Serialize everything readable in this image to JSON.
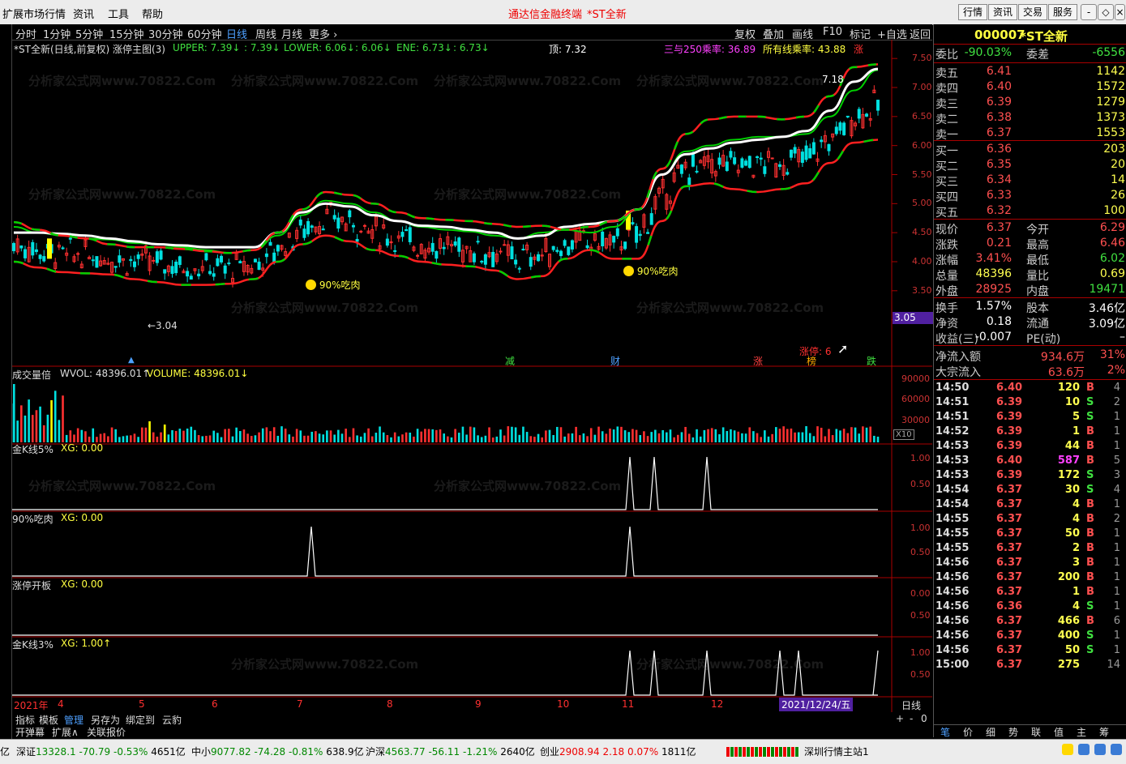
{
  "menubar": {
    "items": [
      "扩展市场行情",
      "资讯",
      "工具",
      "帮助"
    ],
    "title": "通达信金融终端",
    "stock_title": "*ST全新",
    "right_buttons": [
      "行情",
      "资讯",
      "交易",
      "服务"
    ],
    "window_buttons": [
      "-",
      "◇",
      "×"
    ]
  },
  "period_bar": {
    "periods": [
      "分时",
      "1分钟",
      "5分钟",
      "15分钟",
      "30分钟",
      "60分钟",
      "日线",
      "周线",
      "月线",
      "更多 ›"
    ],
    "active": "日线",
    "right": [
      "复权",
      "叠加",
      "画线",
      "F10",
      "标记",
      "+自选",
      "返回"
    ]
  },
  "main_header": {
    "name": "*ST全新(日线,前复权) 涨停主图(3)",
    "upper": "UPPER: 7.39↓",
    "upper2": ": 7.39↓",
    "lower": "LOWER: 6.06↓",
    "lower2": ": 6.06↓",
    "ene": "ENE: 6.73↓",
    "ene2": ": 6.73↓",
    "top": "顶: 7.32",
    "ma250": "三与250乘率: 36.89",
    "allma": "所有线乘率: 43.88",
    "zhang": "涨"
  },
  "chart_data": [
    {
      "type": "line",
      "title": "*ST全新(日线,前复权) 涨停主图(3)",
      "ylim": [
        2.8,
        7.6
      ],
      "yticks": [
        7.5,
        7.0,
        6.5,
        6.0,
        5.5,
        5.0,
        4.5,
        4.0,
        3.5,
        3.0
      ],
      "series": [
        {
          "name": "UPPER",
          "values": [
            4.68,
            4.55,
            4.45,
            4.4,
            4.3,
            4.25,
            4.25,
            4.22,
            4.18,
            4.15,
            4.2,
            4.5,
            4.9,
            5.2,
            5.15,
            5.0,
            4.85,
            4.75,
            4.72,
            4.7,
            4.65,
            4.6,
            4.62,
            4.55,
            4.6,
            4.7,
            4.9,
            5.6,
            6.2,
            6.45,
            6.5,
            6.5,
            6.45,
            6.5,
            6.85,
            7.35,
            7.4
          ]
        },
        {
          "name": "LOWER",
          "values": [
            4.0,
            3.9,
            3.82,
            3.8,
            3.78,
            3.7,
            3.65,
            3.6,
            3.6,
            3.62,
            3.7,
            4.0,
            4.3,
            4.45,
            4.35,
            4.2,
            4.1,
            4.0,
            3.95,
            3.92,
            3.85,
            3.7,
            3.75,
            4.05,
            4.2,
            4.05,
            4.05,
            4.7,
            5.3,
            5.35,
            5.25,
            5.2,
            5.25,
            5.35,
            5.7,
            6.05,
            6.1
          ]
        },
        {
          "name": "ENE",
          "values": [
            4.6,
            4.5,
            4.45,
            4.4,
            4.38,
            4.32,
            4.3,
            4.25,
            4.2,
            4.15,
            4.2,
            4.45,
            4.8,
            5.05,
            5.0,
            4.85,
            4.7,
            4.6,
            4.55,
            4.52,
            4.45,
            4.4,
            4.5,
            4.55,
            4.5,
            4.6,
            4.9,
            5.5,
            5.9,
            6.0,
            6.1,
            6.15,
            6.15,
            6.2,
            6.5,
            6.95,
            7.3
          ]
        },
        {
          "name": "顶",
          "values": [
            4.5,
            4.5,
            4.48,
            4.45,
            4.4,
            4.35,
            4.3,
            4.28,
            4.25,
            4.25,
            4.25,
            4.5,
            4.85,
            5.0,
            4.95,
            4.8,
            4.7,
            4.62,
            4.6,
            4.55,
            4.5,
            4.4,
            4.45,
            4.6,
            4.65,
            4.7,
            4.9,
            5.5,
            5.85,
            5.95,
            6.05,
            6.1,
            6.15,
            6.25,
            6.6,
            7.1,
            7.32
          ]
        }
      ],
      "annotations": [
        "←3.04",
        "90%吃肉",
        "90%吃肉",
        "7.18"
      ],
      "current_price_label": "3.05",
      "bottom_markers": [
        "减",
        "财",
        "涨",
        "榜",
        "跌"
      ],
      "limit_label": "涨停: 6"
    },
    {
      "type": "bar",
      "title": "成交量倍",
      "header": [
        "WVOL: 48396.01↑",
        "VOLUME: 48396.01↓"
      ],
      "yticks": [
        "90000",
        "60000",
        "30000"
      ],
      "unit": "X10"
    },
    {
      "type": "line",
      "title": "金K线5%",
      "header": "XG: 0.00",
      "yticks": [
        "1.00",
        "0.50"
      ]
    },
    {
      "type": "line",
      "title": "90%吃肉",
      "header": "XG: 0.00",
      "yticks": [
        "1.00",
        "0.50"
      ]
    },
    {
      "type": "line",
      "title": "涨停开板",
      "header": "XG: 0.00",
      "yticks": [
        "0.00",
        "0.50"
      ]
    },
    {
      "type": "line",
      "title": "金K线3%",
      "header": "XG: 1.00↑",
      "yticks": [
        "1.00",
        "0.50"
      ]
    }
  ],
  "xaxis": {
    "labels": [
      "2021年",
      "4",
      "5",
      "6",
      "7",
      "8",
      "9",
      "10",
      "11",
      "12"
    ],
    "cursor_date": "2021/12/24/五",
    "period": "日线"
  },
  "right_panel": {
    "code": "000007",
    "name": "*ST全新",
    "weibi": {
      "label": "委比",
      "value": "-90.03%",
      "label2": "委差",
      "value2": "-6556"
    },
    "asks": [
      {
        "label": "卖五",
        "price": "6.41",
        "vol": "1142"
      },
      {
        "label": "卖四",
        "price": "6.40",
        "vol": "1572"
      },
      {
        "label": "卖三",
        "price": "6.39",
        "vol": "1279"
      },
      {
        "label": "卖二",
        "price": "6.38",
        "vol": "1373"
      },
      {
        "label": "卖一",
        "price": "6.37",
        "vol": "1553"
      }
    ],
    "bids": [
      {
        "label": "买一",
        "price": "6.36",
        "vol": "203"
      },
      {
        "label": "买二",
        "price": "6.35",
        "vol": "20"
      },
      {
        "label": "买三",
        "price": "6.34",
        "vol": "14"
      },
      {
        "label": "买四",
        "price": "6.33",
        "vol": "26"
      },
      {
        "label": "买五",
        "price": "6.32",
        "vol": "100"
      }
    ],
    "stats": [
      {
        "l1": "现价",
        "v1": "6.37",
        "l2": "今开",
        "v2": "6.29"
      },
      {
        "l1": "涨跌",
        "v1": "0.21",
        "l2": "最高",
        "v2": "6.46"
      },
      {
        "l1": "涨幅",
        "v1": "3.41%",
        "l2": "最低",
        "v2": "6.02"
      },
      {
        "l1": "总量",
        "v1": "48396",
        "l2": "量比",
        "v2": "0.69"
      },
      {
        "l1": "外盘",
        "v1": "28925",
        "l2": "内盘",
        "v2": "19471"
      }
    ],
    "stats2": [
      {
        "l1": "换手",
        "v1": "1.57%",
        "l2": "股本",
        "v2": "3.46亿"
      },
      {
        "l1": "净资",
        "v1": "0.18",
        "l2": "流通",
        "v2": "3.09亿"
      },
      {
        "l1": "收益(三)",
        "v1": "-0.007",
        "l2": "PE(动)",
        "v2": "–"
      }
    ],
    "flow": [
      {
        "label": "净流入额",
        "value": "934.6万",
        "pct": "31%"
      },
      {
        "label": "大宗流入",
        "value": "63.6万",
        "pct": "2%"
      }
    ],
    "ticks": [
      {
        "t": "14:50",
        "p": "6.40",
        "v": "120",
        "bs": "B",
        "n": "4"
      },
      {
        "t": "14:51",
        "p": "6.39",
        "v": "10",
        "bs": "S",
        "n": "2"
      },
      {
        "t": "14:51",
        "p": "6.39",
        "v": "5",
        "bs": "S",
        "n": "1"
      },
      {
        "t": "14:52",
        "p": "6.39",
        "v": "1",
        "bs": "B",
        "n": "1"
      },
      {
        "t": "14:53",
        "p": "6.39",
        "v": "44",
        "bs": "B",
        "n": "1"
      },
      {
        "t": "14:53",
        "p": "6.40",
        "v": "587",
        "bs": "B",
        "n": "5"
      },
      {
        "t": "14:53",
        "p": "6.39",
        "v": "172",
        "bs": "S",
        "n": "3"
      },
      {
        "t": "14:54",
        "p": "6.37",
        "v": "30",
        "bs": "S",
        "n": "4"
      },
      {
        "t": "14:54",
        "p": "6.37",
        "v": "4",
        "bs": "B",
        "n": "1"
      },
      {
        "t": "14:55",
        "p": "6.37",
        "v": "4",
        "bs": "B",
        "n": "2"
      },
      {
        "t": "14:55",
        "p": "6.37",
        "v": "50",
        "bs": "B",
        "n": "1"
      },
      {
        "t": "14:55",
        "p": "6.37",
        "v": "2",
        "bs": "B",
        "n": "1"
      },
      {
        "t": "14:56",
        "p": "6.37",
        "v": "3",
        "bs": "B",
        "n": "1"
      },
      {
        "t": "14:56",
        "p": "6.37",
        "v": "200",
        "bs": "B",
        "n": "1"
      },
      {
        "t": "14:56",
        "p": "6.37",
        "v": "1",
        "bs": "B",
        "n": "1"
      },
      {
        "t": "14:56",
        "p": "6.36",
        "v": "4",
        "bs": "S",
        "n": "1"
      },
      {
        "t": "14:56",
        "p": "6.37",
        "v": "466",
        "bs": "B",
        "n": "6"
      },
      {
        "t": "14:56",
        "p": "6.37",
        "v": "400",
        "bs": "S",
        "n": "1"
      },
      {
        "t": "14:56",
        "p": "6.37",
        "v": "50",
        "bs": "S",
        "n": "1"
      },
      {
        "t": "15:00",
        "p": "6.37",
        "v": "275",
        "bs": "",
        "n": "14"
      }
    ],
    "bottom_tabs": [
      "笔",
      "价",
      "细",
      "势",
      "联",
      "值",
      "主",
      "筹"
    ]
  },
  "bottom_tabs": {
    "row1": [
      "指标",
      "模板",
      "管理",
      "另存为",
      "绑定到",
      "云豹"
    ],
    "row2": [
      "开弹幕",
      "扩展∧",
      "关联报价"
    ]
  },
  "status": {
    "items": [
      {
        "label": "亿",
        "value": ""
      },
      {
        "label": "深证",
        "value": "13328.1",
        "chg": "-70.79",
        "pct": "-0.53%",
        "amt": "4651亿"
      },
      {
        "label": "中小",
        "value": "9077.82",
        "chg": "-74.28",
        "pct": "-0.81%",
        "amt": "638.9亿"
      },
      {
        "label": "沪深",
        "value": "4563.77",
        "chg": "-56.11",
        "pct": "-1.21%",
        "amt": "2640亿"
      },
      {
        "label": "创业",
        "value": "2908.94",
        "chg": "2.18",
        "pct": "0.07%",
        "amt": "1811亿"
      }
    ],
    "server": "深圳行情主站1"
  },
  "colors": {
    "up": "#ff3030",
    "down": "#00e0e0",
    "upper": "#ff2020",
    "lower": "#ff2020",
    "ene": "#00d000",
    "top": "#ffffff",
    "accent": "#4ea0ff"
  }
}
